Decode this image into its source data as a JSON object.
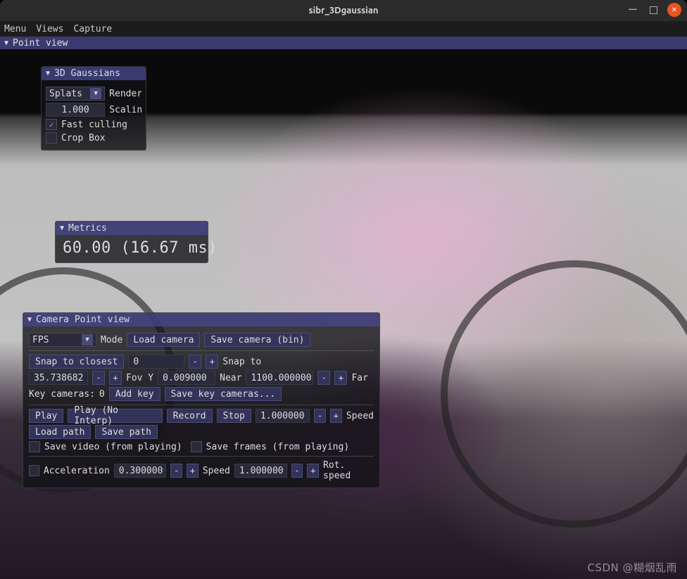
{
  "window": {
    "title": "sibr_3Dgaussian"
  },
  "menubar": {
    "items": [
      "Menu",
      "Views",
      "Capture"
    ]
  },
  "pointview": {
    "title": "Point view"
  },
  "gaussians": {
    "title": "3D Gaussians",
    "render_combo": "Splats",
    "render_label": "Render",
    "scale_value": "1.000",
    "scale_label": "Scalin",
    "fast_culling_checked": true,
    "fast_culling_label": "Fast culling",
    "crop_box_checked": false,
    "crop_box_label": "Crop Box"
  },
  "metrics": {
    "title": "Metrics",
    "fps": "60.00",
    "ms": "(16.67 ms)"
  },
  "camera": {
    "title": "Camera Point view",
    "mode_combo": "FPS",
    "mode_label": "Mode",
    "load_camera": "Load camera",
    "save_camera": "Save camera (bin)",
    "snap_btn": "Snap to closest",
    "snap_value": "0",
    "snap_to_label": "Snap to",
    "fovy_value": "35.738682",
    "fovy_label": "Fov Y",
    "near_value": "0.009000",
    "near_label": "Near",
    "far_value": "1100.000000",
    "far_label": "Far",
    "key_cams_label": "Key cameras:",
    "key_cams_count": "0",
    "add_key": "Add key",
    "save_key_cams": "Save key cameras...",
    "play": "Play",
    "play_noi": "Play (No Interp)",
    "record": "Record",
    "stop": "Stop",
    "speed_value": "1.000000",
    "speed_label": "Speed",
    "load_path": "Load path",
    "save_path": "Save path",
    "save_video_label": "Save video (from playing)",
    "save_frames_label": "Save frames (from playing)",
    "accel_label": "Acceleration",
    "accel_value": "0.300000",
    "speed2_label": "Speed",
    "speed2_value": "1.000000",
    "rot_speed_label": "Rot. speed"
  },
  "watermark": "CSDN @糊烟乱雨"
}
